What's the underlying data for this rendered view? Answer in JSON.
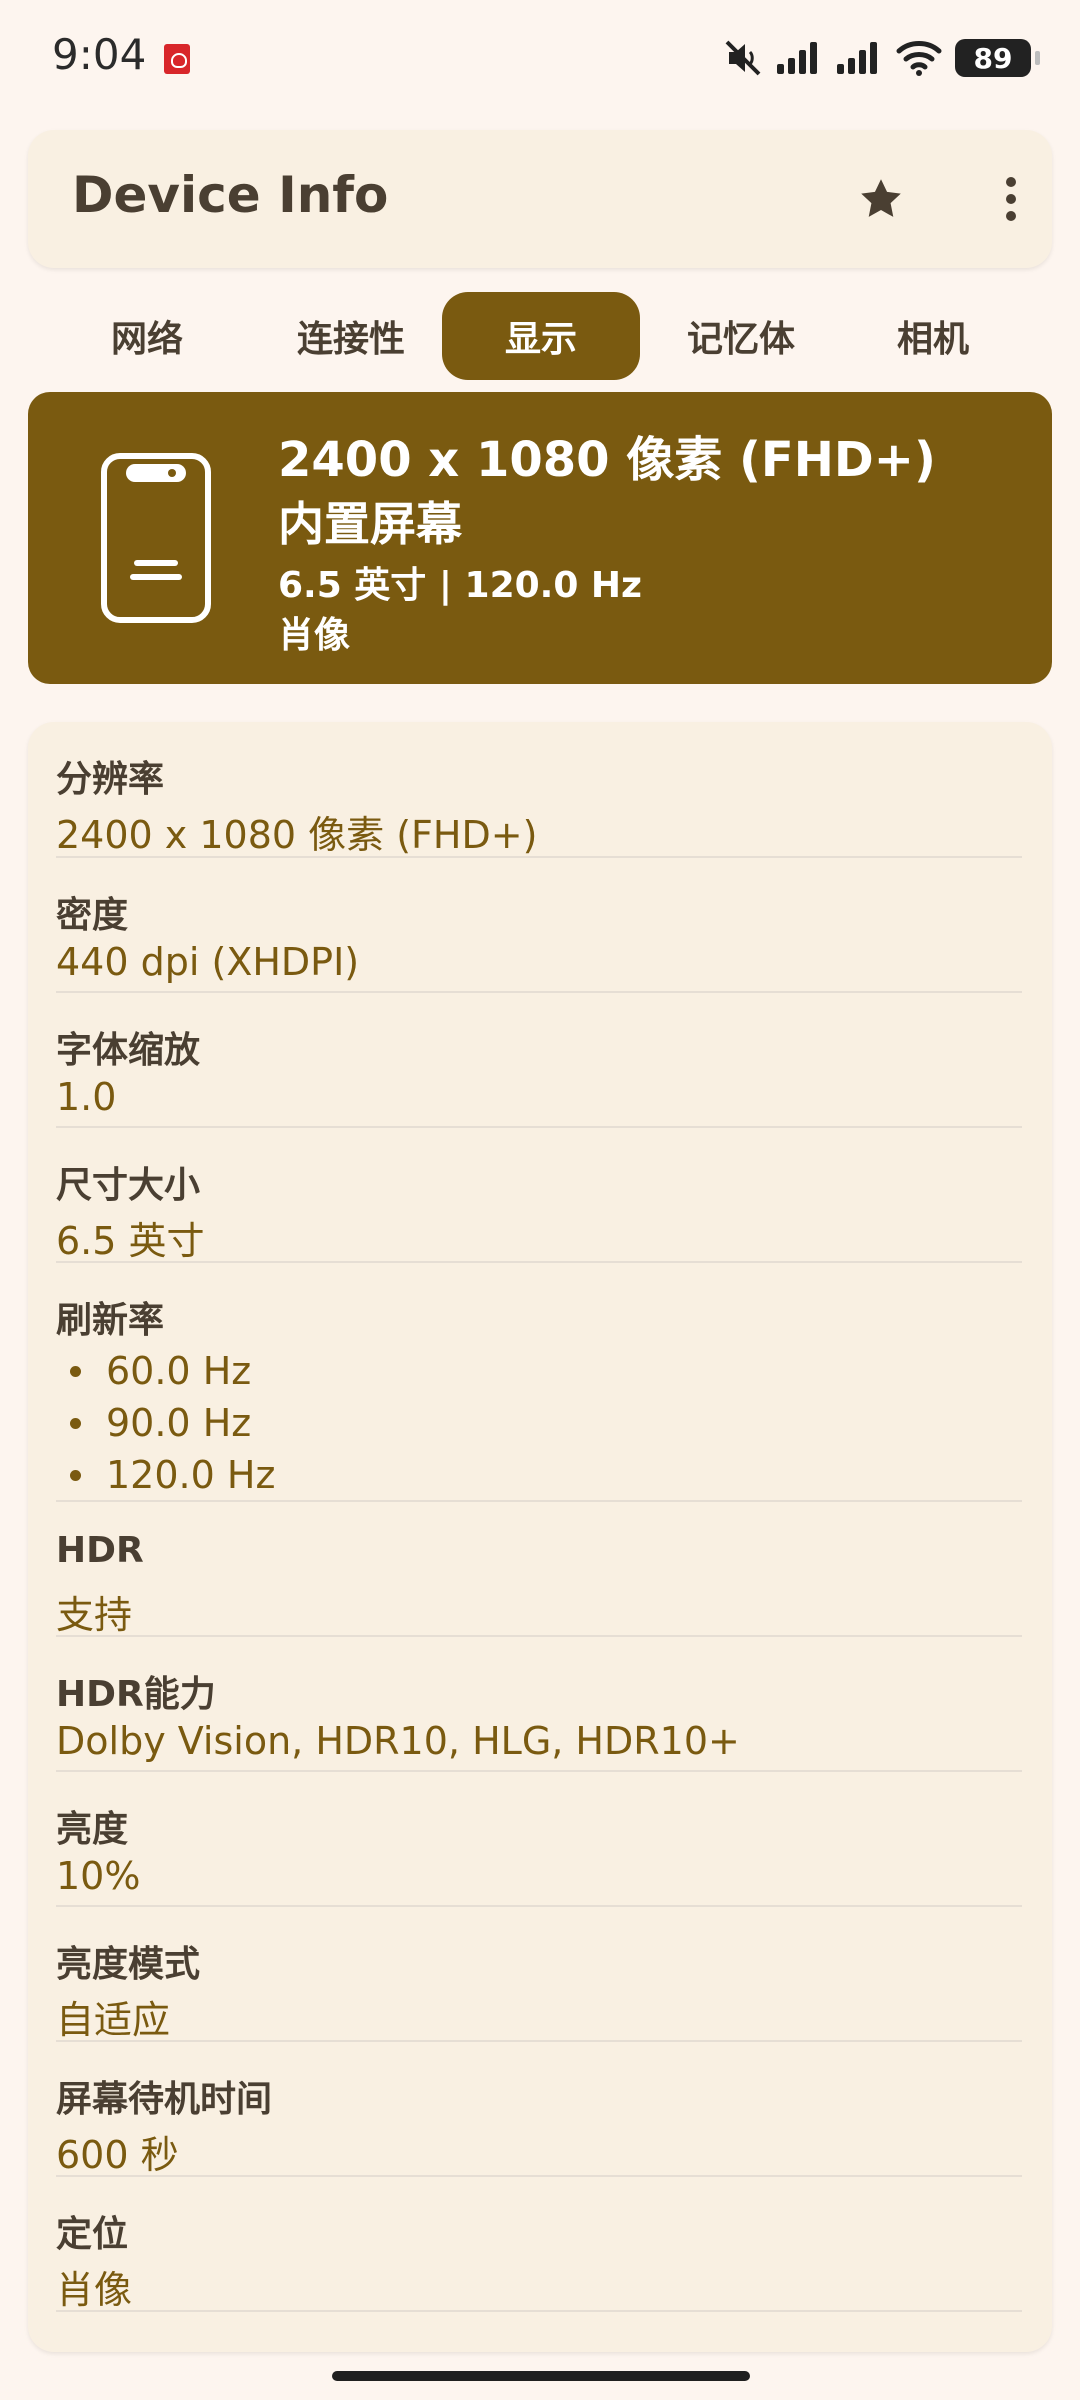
{
  "status_bar": {
    "time": "9:04",
    "battery_level": "89",
    "icons": [
      "app-notification-icon",
      "mute-icon",
      "signal-icon",
      "signal-icon",
      "wifi-icon",
      "battery-icon"
    ]
  },
  "appbar": {
    "title": "Device Info",
    "icons": [
      "star-icon",
      "more-vert-icon"
    ]
  },
  "tabs": [
    {
      "label": "网络"
    },
    {
      "label": "连接性"
    },
    {
      "label": "显示",
      "active": true
    },
    {
      "label": "记忆体"
    },
    {
      "label": "相机"
    }
  ],
  "hero": {
    "title": "2400 x 1080 像素 (FHD+)",
    "subtitle": "内置屏幕",
    "line3": "6.5 英寸 | 120.0 Hz",
    "line4": "肖像",
    "icon": "phone-icon"
  },
  "rows": [
    {
      "label": "分辨率",
      "value": "2400 x 1080 像素 (FHD+)"
    },
    {
      "label": "密度",
      "value": "440 dpi (XHDPI)"
    },
    {
      "label": "字体缩放",
      "value": "1.0"
    },
    {
      "label": "尺寸大小",
      "value": "6.5 英寸"
    },
    {
      "label": "刷新率",
      "values": [
        "60.0 Hz",
        "90.0 Hz",
        "120.0 Hz"
      ]
    },
    {
      "label": "HDR",
      "value": "支持"
    },
    {
      "label": "HDR能力",
      "value": "Dolby Vision, HDR10, HLG, HDR10+"
    },
    {
      "label": "亮度",
      "value": "10%"
    },
    {
      "label": "亮度模式",
      "value": "自适应"
    },
    {
      "label": "屏幕待机时间",
      "value": "600 秒"
    },
    {
      "label": "定位",
      "value": "肖像"
    }
  ],
  "colors": {
    "accent": "#7A5A10",
    "background": "#FDF5EF",
    "card": "#F9F0E2",
    "text": "#4A3F32"
  }
}
